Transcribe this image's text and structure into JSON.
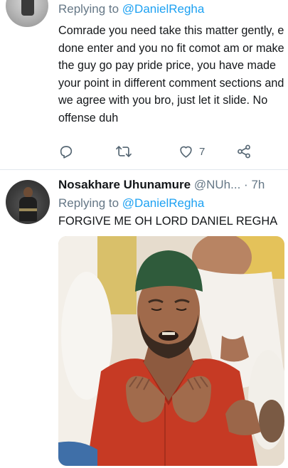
{
  "tweet1": {
    "replying_prefix": "Replying to ",
    "replying_handle": "@DanielRegha",
    "text": "Comrade you need take this matter gently, e done enter and you no fit comot am or make the guy go pay pride price, you have made your point in different comment sections and we agree with you bro, just let it slide. No offense duh",
    "actions": {
      "reply_icon": "reply-icon",
      "retweet_icon": "retweet-icon",
      "like_icon": "heart-icon",
      "like_count": "7",
      "share_icon": "share-icon"
    }
  },
  "tweet2": {
    "author_name": "Nosakhare Uhunamure",
    "author_handle": "@NUh...",
    "separator": "·",
    "time": "7h",
    "menu_icon": "chevron-down-icon",
    "replying_prefix": "Replying to ",
    "replying_handle": "@DanielRegha",
    "text": "FORGIVE ME OH LORD DANIEL REGHA",
    "media_description_icon": "photo-praying-man"
  },
  "colors": {
    "text": "#14171a",
    "secondary": "#657786",
    "link": "#1da1f2",
    "divider": "#e1e8ed"
  }
}
